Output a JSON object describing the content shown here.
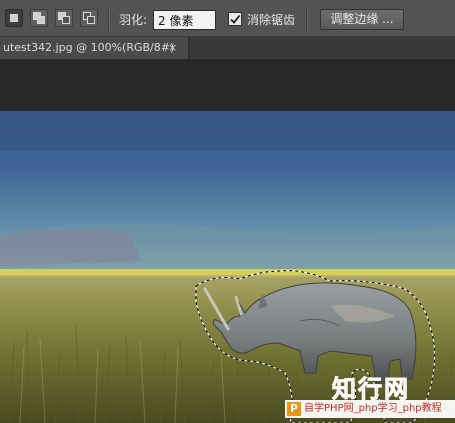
{
  "options_bar": {
    "selection_modes": [
      "new-selection",
      "add-to-selection",
      "subtract-from-selection",
      "intersect-with-selection"
    ],
    "feather_label": "羽化:",
    "feather_value": "2 像素",
    "antialias_checked": true,
    "antialias_label": "消除锯齿",
    "refine_edge_label": "调整边缘 ..."
  },
  "document_tab": {
    "title": "utest342.jpg @ 100%(RGB/8#)",
    "close_glyph": "×"
  },
  "watermark": {
    "logo_text": "知行网",
    "icon_letter": "P",
    "banner_text": "自学PHP网_php学习_php教程"
  },
  "colors": {
    "options_bar_bg": "#535353",
    "canvas_bg": "#282828",
    "watermark_red": "#d32a1e"
  }
}
